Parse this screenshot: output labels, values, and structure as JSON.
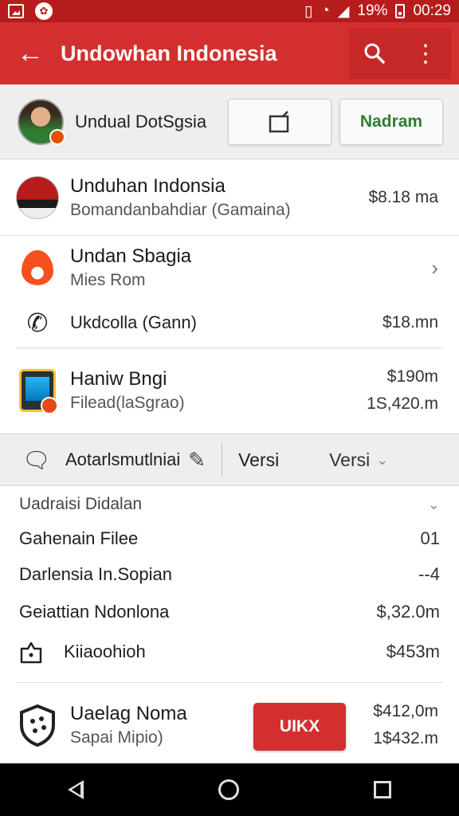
{
  "status_bar": {
    "battery": "19%",
    "time": "00:29"
  },
  "app_bar": {
    "title": "Undowhan Indonesia",
    "back_icon": "arrow-left-icon",
    "search_icon": "search-icon",
    "menu_icon": "more-vert-icon"
  },
  "profile": {
    "name": "Undual DotSgsia",
    "action_icon": "tablet-icon",
    "primary_label": "Nadram"
  },
  "items": [
    {
      "title": "Unduhan Indonsia",
      "subtitle": "Bomandanbahdiar (Gamaina)",
      "value": "$8.18 ma"
    },
    {
      "title": "Undan Sbagia",
      "subtitle": "Mies Rom"
    },
    {
      "title": "Ukdcolla  (Gann)",
      "value": "$18.mn"
    },
    {
      "title": "Haniw Bngi",
      "subtitle": "Filead(laSgrao)",
      "value": "$190m",
      "value2": "1S,420.m"
    }
  ],
  "toolbar": {
    "label": "Aotarlsmutlniai",
    "versi_left": "Versi",
    "versi_right": "Versi"
  },
  "details": {
    "header": "Uadraisi Didalan",
    "rows": [
      {
        "label": "Gahenain Filee",
        "value": "01"
      },
      {
        "label": "Darlensia In.Sopian",
        "value": "--4"
      },
      {
        "label": "Geiattian Ndonlona",
        "value": "$,32.0m"
      },
      {
        "label": "Kiiaoohioh",
        "value": "$453m"
      }
    ]
  },
  "bottom_app": {
    "title": "Uaelag Noma",
    "subtitle": "Sapai Mipio)",
    "button_label": "UIKX",
    "value": "$412,0m",
    "value2": "1$432.m"
  }
}
